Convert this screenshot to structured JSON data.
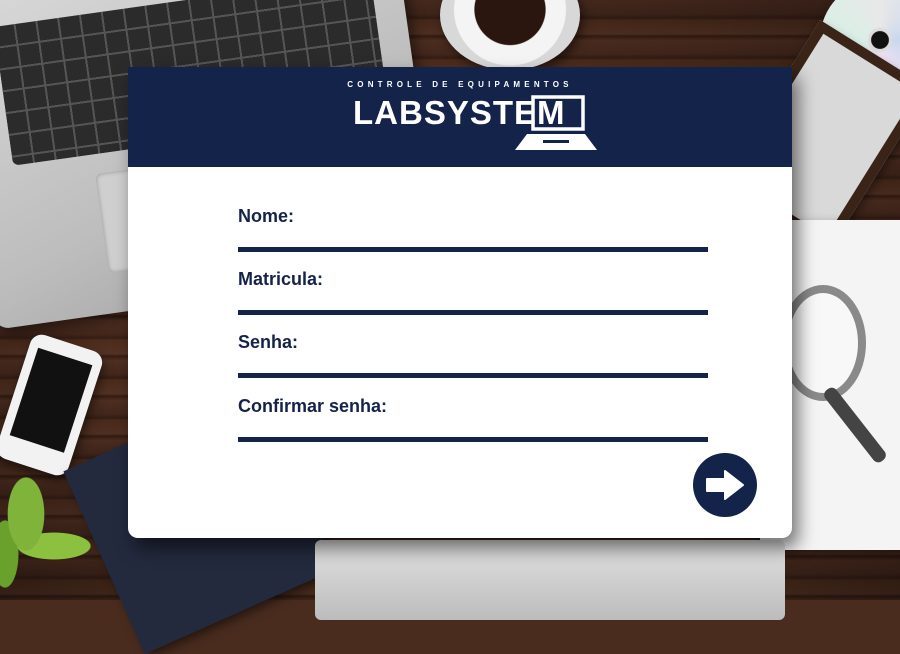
{
  "app": {
    "subtitle": "CONTROLE DE EQUIPAMENTOS",
    "title": "LABSYSTEM"
  },
  "form": {
    "fields": [
      {
        "label": "Nome:",
        "value": "",
        "placeholder": ""
      },
      {
        "label": "Matricula:",
        "value": "",
        "placeholder": ""
      },
      {
        "label": "Senha:",
        "value": "",
        "placeholder": ""
      },
      {
        "label": "Confirmar senha:",
        "value": "",
        "placeholder": ""
      }
    ],
    "submit_icon": "arrow-right-icon"
  },
  "colors": {
    "primary": "#13234a",
    "card_background": "#ffffff"
  }
}
